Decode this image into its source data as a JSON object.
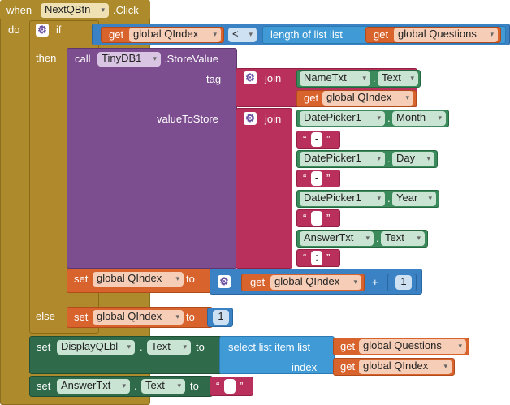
{
  "event": {
    "when": "when",
    "component": "NextQBtn",
    "event_name": ".Click",
    "do": "do"
  },
  "if_block": {
    "if_label": "if",
    "then_label": "then",
    "else_label": "else"
  },
  "condition": {
    "get": "get",
    "var": "global QIndex",
    "op": "<",
    "length_label": "length of list  list",
    "get2": "get",
    "var2": "global Questions"
  },
  "store": {
    "call": "call",
    "component": "TinyDB1",
    "method": ".StoreValue",
    "tag": "tag",
    "value": "valueToStore"
  },
  "tag_join": {
    "join": "join",
    "comp": "NameTxt",
    "dot": ".",
    "prop": "Text",
    "get": "get",
    "var": "global QIndex"
  },
  "value_join": {
    "join": "join",
    "rows": [
      {
        "comp": "DatePicker1",
        "prop": "Month"
      },
      {
        "comp": "DatePicker1",
        "prop": "Day"
      },
      {
        "comp": "DatePicker1",
        "prop": "Year"
      },
      {
        "comp": "AnswerTxt",
        "prop": "Text"
      }
    ],
    "strings": [
      "-",
      "-",
      "",
      ":"
    ],
    "quote_open": "“",
    "quote_close": "”",
    "dot": "."
  },
  "set_inc": {
    "set": "set",
    "var": "global QIndex",
    "to": "to",
    "get": "get",
    "var2": "global QIndex",
    "plus": "+",
    "num": "1"
  },
  "else_set": {
    "set": "set",
    "var": "global QIndex",
    "to": "to",
    "num": "1"
  },
  "set_label": {
    "set": "set",
    "comp": "DisplayQLbl",
    "dot": ".",
    "prop": "Text",
    "to": "to",
    "select": "select list item  list",
    "index": "index",
    "get1": "get",
    "var1": "global Questions",
    "get2": "get",
    "var2": "global QIndex"
  },
  "set_answer": {
    "set": "set",
    "comp": "AnswerTxt",
    "dot": ".",
    "prop": "Text",
    "to": "to",
    "str": ""
  },
  "dropdown_glyph": "▾",
  "gear_glyph": "⚙"
}
